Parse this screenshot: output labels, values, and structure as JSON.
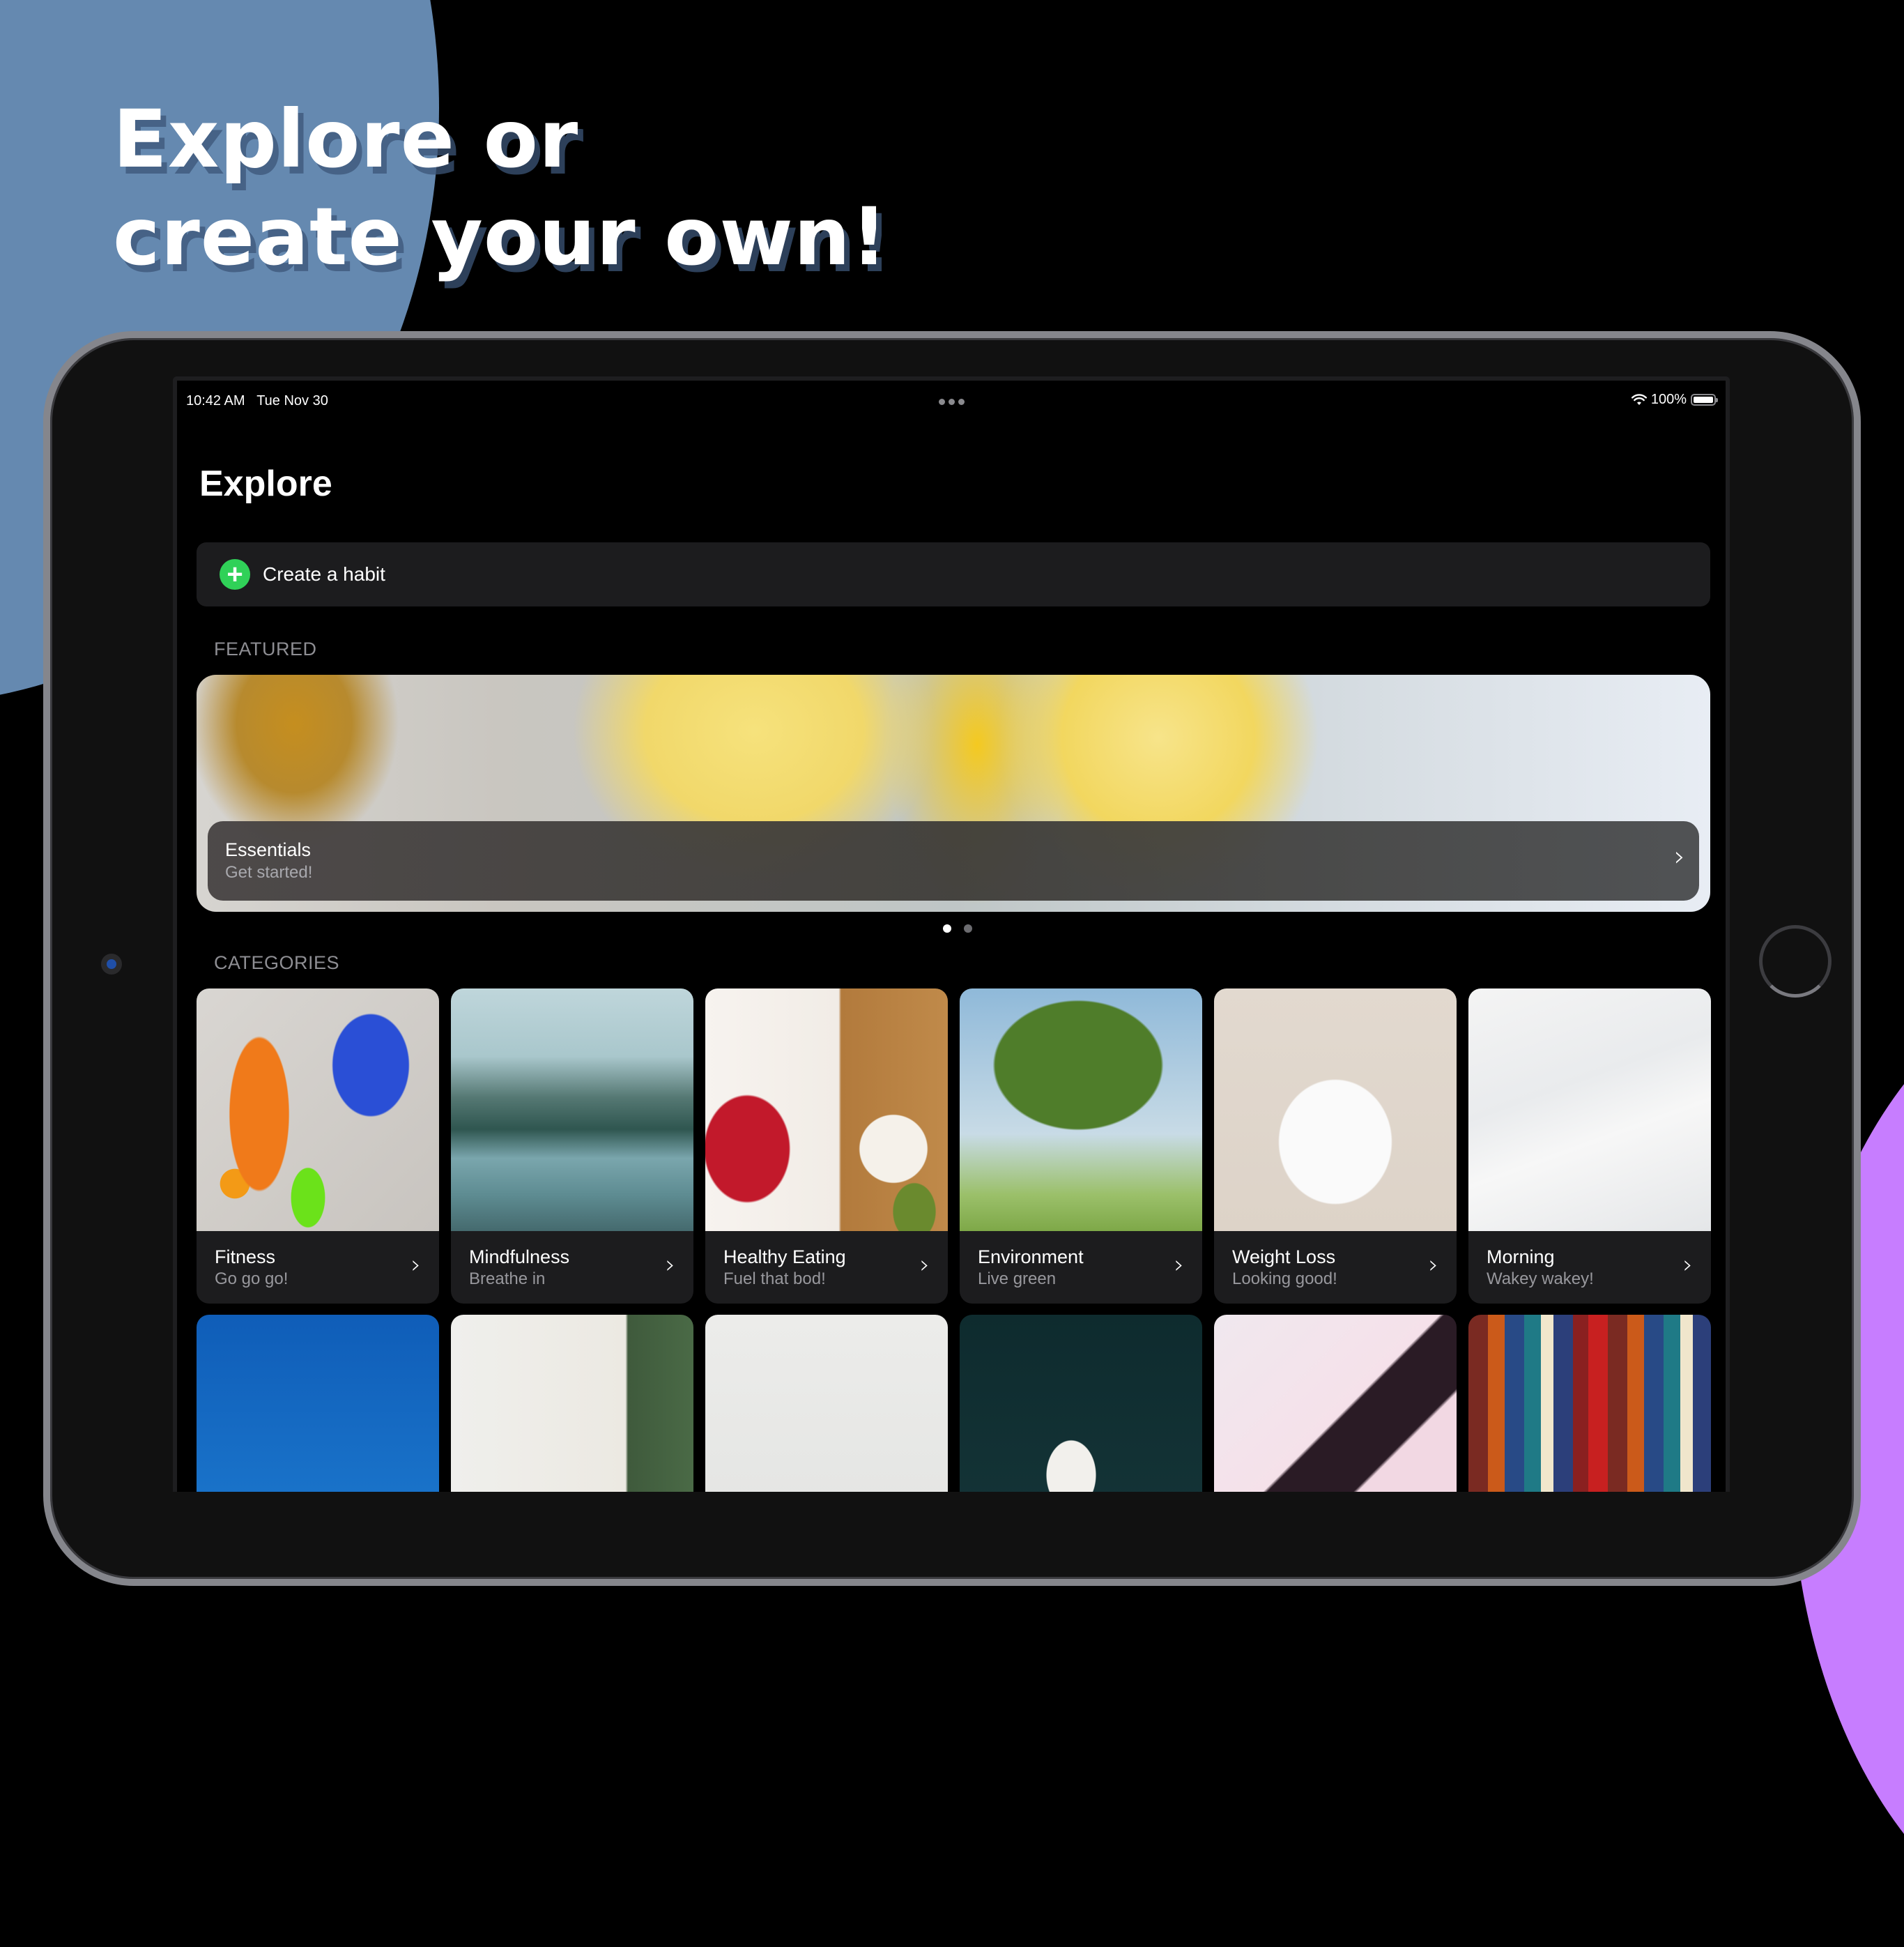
{
  "marketing": {
    "headline_line1": "Explore or",
    "headline_line2": "create your own!",
    "colors": {
      "blue_blob": "#6589b0",
      "purple_blob": "#c77dff",
      "background": "#000000"
    }
  },
  "status_bar": {
    "time": "10:42 AM",
    "date": "Tue Nov 30",
    "battery_text": "100%",
    "battery_level": 1.0,
    "wifi_icon": "wifi-icon",
    "multitasking_icon": "ellipsis-icon"
  },
  "page": {
    "title": "Explore"
  },
  "create_habit": {
    "label": "Create a habit",
    "icon": "plus-circle-icon",
    "icon_color": "#30d158"
  },
  "featured": {
    "section_label": "FEATURED",
    "items": [
      {
        "title": "Essentials",
        "subtitle": "Get started!"
      }
    ],
    "page_count": 2,
    "current_page": 1
  },
  "categories": {
    "section_label": "CATEGORIES",
    "items": [
      {
        "title": "Fitness",
        "subtitle": "Go go go!"
      },
      {
        "title": "Mindfulness",
        "subtitle": "Breathe in"
      },
      {
        "title": "Healthy Eating",
        "subtitle": "Fuel that bod!"
      },
      {
        "title": "Environment",
        "subtitle": "Live green"
      },
      {
        "title": "Weight Loss",
        "subtitle": "Looking good!"
      },
      {
        "title": "Morning",
        "subtitle": "Wakey wakey!"
      }
    ]
  },
  "chevron_glyph": "›"
}
